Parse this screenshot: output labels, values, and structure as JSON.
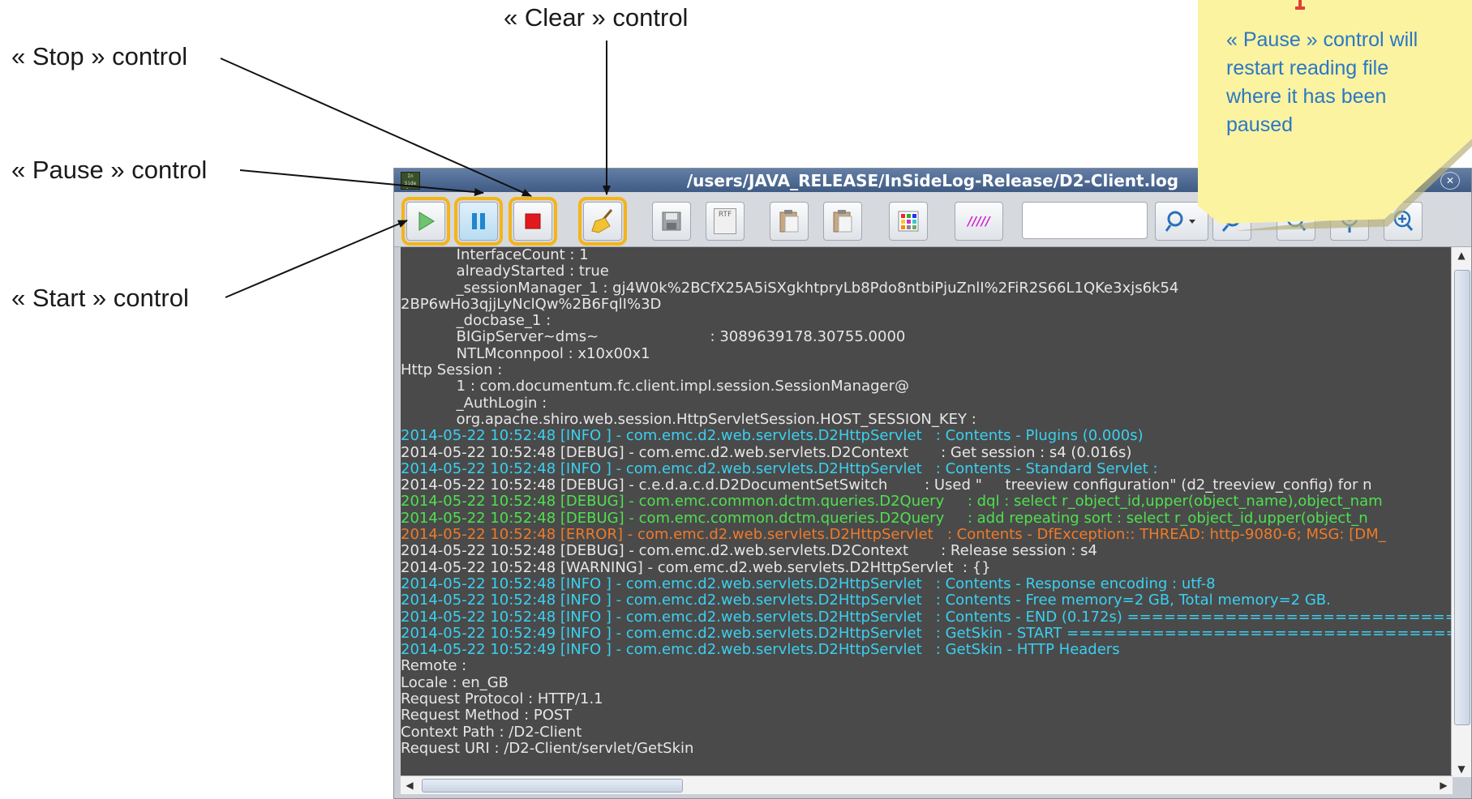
{
  "annotations": {
    "stop": "« Stop » control",
    "pause": "« Pause » control",
    "start": "« Start » control",
    "clear": "« Clear » control"
  },
  "note": {
    "text": "« Pause » control will restart reading file where it has been paused",
    "color": "#fbf39f",
    "text_color": "#2a77c8"
  },
  "window": {
    "title": "/users/JAVA_RELEASE/InSideLog-Release/D2-Client.log",
    "logo_text": "In Side log"
  },
  "toolbar": {
    "start_icon": "play-icon",
    "pause_icon": "pause-icon",
    "stop_icon": "stop-icon",
    "clear_icon": "broom-icon",
    "save_icon": "save-icon",
    "rtf_label": "RTF",
    "copy_icon": "copy-icon",
    "paste_icon": "paste-icon",
    "colors_icon": "color-grid-icon",
    "filter_label": "/////",
    "search_value": "",
    "highlight_color": "#f4b41a"
  },
  "log_lines": [
    {
      "cls": "white",
      "text": "            InterfaceCount : 1"
    },
    {
      "cls": "white",
      "text": "            alreadyStarted : true"
    },
    {
      "cls": "white",
      "text": "            _sessionManager_1 : gj4W0k%2BCfX25A5iSXgkhtpryLb8Pdo8ntbiPjuZnlI%2FiR2S66L1QKe3xjs6k54"
    },
    {
      "cls": "white",
      "text": "2BP6wHo3qjjLyNclQw%2B6FqlI%3D"
    },
    {
      "cls": "white",
      "text": "            _docbase_1 :"
    },
    {
      "cls": "white",
      "text": "            BIGipServer~dms~                        : 3089639178.30755.0000"
    },
    {
      "cls": "white",
      "text": "            NTLMconnpool : x10x00x1"
    },
    {
      "cls": "white",
      "text": "Http Session :"
    },
    {
      "cls": "white",
      "text": "            1 : com.documentum.fc.client.impl.session.SessionManager@"
    },
    {
      "cls": "white",
      "text": "            _AuthLogin :"
    },
    {
      "cls": "white",
      "text": "            org.apache.shiro.web.session.HttpServletSession.HOST_SESSION_KEY :"
    },
    {
      "cls": "cyan",
      "text": "2014-05-22 10:52:48 [INFO ] - com.emc.d2.web.servlets.D2HttpServlet   : Contents - Plugins (0.000s)"
    },
    {
      "cls": "white",
      "text": "2014-05-22 10:52:48 [DEBUG] - com.emc.d2.web.servlets.D2Context       : Get session : s4 (0.016s)"
    },
    {
      "cls": "cyan",
      "text": "2014-05-22 10:52:48 [INFO ] - com.emc.d2.web.servlets.D2HttpServlet   : Contents - Standard Servlet :"
    },
    {
      "cls": "white",
      "text": "2014-05-22 10:52:48 [DEBUG] - c.e.d.a.c.d.D2DocumentSetSwitch        : Used \"     treeview configuration\" (d2_treeview_config) for n"
    },
    {
      "cls": "green",
      "text": "2014-05-22 10:52:48 [DEBUG] - com.emc.common.dctm.queries.D2Query     : dql : select r_object_id,upper(object_name),object_nam"
    },
    {
      "cls": "green",
      "text": "2014-05-22 10:52:48 [DEBUG] - com.emc.common.dctm.queries.D2Query     : add repeating sort : select r_object_id,upper(object_n"
    },
    {
      "cls": "orange",
      "text": "2014-05-22 10:52:48 [ERROR] - com.emc.d2.web.servlets.D2HttpServlet   : Contents - DfException:: THREAD: http-9080-6; MSG: [DM_"
    },
    {
      "cls": "white",
      "text": "2014-05-22 10:52:48 [DEBUG] - com.emc.d2.web.servlets.D2Context       : Release session : s4"
    },
    {
      "cls": "white",
      "text": "2014-05-22 10:52:48 [WARNING] - com.emc.d2.web.servlets.D2HttpServlet  : {}"
    },
    {
      "cls": "cyan",
      "text": "2014-05-22 10:52:48 [INFO ] - com.emc.d2.web.servlets.D2HttpServlet   : Contents - Response encoding : utf-8"
    },
    {
      "cls": "cyan",
      "text": "2014-05-22 10:52:48 [INFO ] - com.emc.d2.web.servlets.D2HttpServlet   : Contents - Free memory=2 GB, Total memory=2 GB."
    },
    {
      "cls": "cyan",
      "text": "2014-05-22 10:52:48 [INFO ] - com.emc.d2.web.servlets.D2HttpServlet   : Contents - END (0.172s) ============================"
    },
    {
      "cls": "cyan",
      "text": "2014-05-22 10:52:49 [INFO ] - com.emc.d2.web.servlets.D2HttpServlet   : GetSkin - START ===================================="
    },
    {
      "cls": "cyan",
      "text": "2014-05-22 10:52:49 [INFO ] - com.emc.d2.web.servlets.D2HttpServlet   : GetSkin - HTTP Headers"
    },
    {
      "cls": "white",
      "text": "Remote :"
    },
    {
      "cls": "white",
      "text": "Locale : en_GB"
    },
    {
      "cls": "white",
      "text": "Request Protocol : HTTP/1.1"
    },
    {
      "cls": "white",
      "text": "Request Method : POST"
    },
    {
      "cls": "white",
      "text": "Context Path : /D2-Client"
    },
    {
      "cls": "white",
      "text": "Request URI : /D2-Client/servlet/GetSkin"
    }
  ]
}
